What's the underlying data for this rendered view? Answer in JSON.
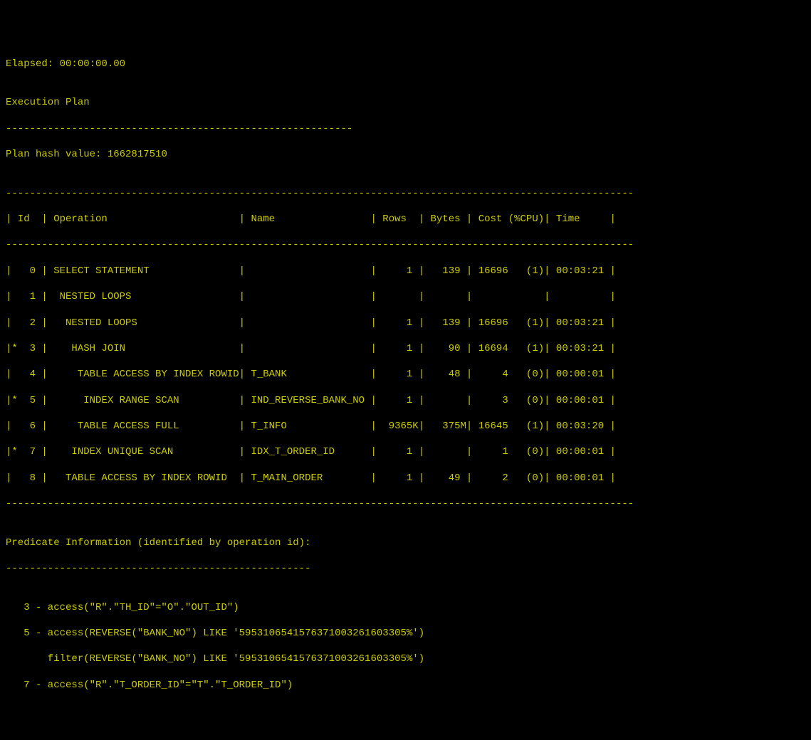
{
  "elapsed_label": "Elapsed: ",
  "elapsed_value": "00:00:00.00",
  "blank1": "",
  "exec_plan_title": "Execution Plan",
  "exec_plan_divider": "----------------------------------------------------------",
  "plan_hash_label": "Plan hash value: ",
  "plan_hash_value": "1662817510",
  "blank2": "",
  "table_divider": "---------------------------------------------------------------------------------------------------------",
  "header_row": "| Id  | Operation                      | Name                | Rows  | Bytes | Cost (%CPU)| Time     |",
  "rows": [
    "|   0 | SELECT STATEMENT               |                     |     1 |   139 | 16696   (1)| 00:03:21 |",
    "|   1 |  NESTED LOOPS                  |                     |       |       |            |          |",
    "|   2 |   NESTED LOOPS                 |                     |     1 |   139 | 16696   (1)| 00:03:21 |",
    "|*  3 |    HASH JOIN                   |                     |     1 |    90 | 16694   (1)| 00:03:21 |",
    "|   4 |     TABLE ACCESS BY INDEX ROWID| T_BANK              |     1 |    48 |     4   (0)| 00:00:01 |",
    "|*  5 |      INDEX RANGE SCAN          | IND_REVERSE_BANK_NO |     1 |       |     3   (0)| 00:00:01 |",
    "|   6 |     TABLE ACCESS FULL          | T_INFO              |  9365K|   375M| 16645   (1)| 00:03:20 |",
    "|*  7 |    INDEX UNIQUE SCAN           | IDX_T_ORDER_ID      |     1 |       |     1   (0)| 00:00:01 |",
    "|   8 |   TABLE ACCESS BY INDEX ROWID  | T_MAIN_ORDER        |     1 |    49 |     2   (0)| 00:00:01 |"
  ],
  "blank3": "",
  "predicate_title": "Predicate Information (identified by operation id):",
  "predicate_divider": "---------------------------------------------------",
  "blank4": "",
  "predicates": [
    "   3 - access(\"R\".\"TH_ID\"=\"O\".\"OUT_ID\")",
    "   5 - access(REVERSE(\"BANK_NO\") LIKE '5953106541576371003261603305%')",
    "       filter(REVERSE(\"BANK_NO\") LIKE '5953106541576371003261603305%')",
    "   7 - access(\"R\".\"T_ORDER_ID\"=\"T\".\"T_ORDER_ID\")"
  ],
  "chart_data": {
    "type": "table",
    "title": "Execution Plan",
    "plan_hash_value": 1662817510,
    "elapsed": "00:00:00.00",
    "columns": [
      "Id",
      "Operation",
      "Name",
      "Rows",
      "Bytes",
      "Cost (%CPU)",
      "Time"
    ],
    "data": [
      {
        "id": 0,
        "flag": "",
        "operation": "SELECT STATEMENT",
        "name": "",
        "rows": 1,
        "bytes": 139,
        "cost": 16696,
        "cpu_pct": 1,
        "time": "00:03:21"
      },
      {
        "id": 1,
        "flag": "",
        "operation": "NESTED LOOPS",
        "name": "",
        "rows": null,
        "bytes": null,
        "cost": null,
        "cpu_pct": null,
        "time": ""
      },
      {
        "id": 2,
        "flag": "",
        "operation": "NESTED LOOPS",
        "name": "",
        "rows": 1,
        "bytes": 139,
        "cost": 16696,
        "cpu_pct": 1,
        "time": "00:03:21"
      },
      {
        "id": 3,
        "flag": "*",
        "operation": "HASH JOIN",
        "name": "",
        "rows": 1,
        "bytes": 90,
        "cost": 16694,
        "cpu_pct": 1,
        "time": "00:03:21"
      },
      {
        "id": 4,
        "flag": "",
        "operation": "TABLE ACCESS BY INDEX ROWID",
        "name": "T_BANK",
        "rows": 1,
        "bytes": 48,
        "cost": 4,
        "cpu_pct": 0,
        "time": "00:00:01"
      },
      {
        "id": 5,
        "flag": "*",
        "operation": "INDEX RANGE SCAN",
        "name": "IND_REVERSE_BANK_NO",
        "rows": 1,
        "bytes": null,
        "cost": 3,
        "cpu_pct": 0,
        "time": "00:00:01"
      },
      {
        "id": 6,
        "flag": "",
        "operation": "TABLE ACCESS FULL",
        "name": "T_INFO",
        "rows": "9365K",
        "bytes": "375M",
        "cost": 16645,
        "cpu_pct": 1,
        "time": "00:03:20"
      },
      {
        "id": 7,
        "flag": "*",
        "operation": "INDEX UNIQUE SCAN",
        "name": "IDX_T_ORDER_ID",
        "rows": 1,
        "bytes": null,
        "cost": 1,
        "cpu_pct": 0,
        "time": "00:00:01"
      },
      {
        "id": 8,
        "flag": "",
        "operation": "TABLE ACCESS BY INDEX ROWID",
        "name": "T_MAIN_ORDER",
        "rows": 1,
        "bytes": 49,
        "cost": 2,
        "cpu_pct": 0,
        "time": "00:00:01"
      }
    ],
    "predicates": [
      {
        "id": 3,
        "type": "access",
        "expr": "\"R\".\"TH_ID\"=\"O\".\"OUT_ID\""
      },
      {
        "id": 5,
        "type": "access",
        "expr": "REVERSE(\"BANK_NO\") LIKE '5953106541576371003261603305%'"
      },
      {
        "id": 5,
        "type": "filter",
        "expr": "REVERSE(\"BANK_NO\") LIKE '5953106541576371003261603305%'"
      },
      {
        "id": 7,
        "type": "access",
        "expr": "\"R\".\"T_ORDER_ID\"=\"T\".\"T_ORDER_ID\""
      }
    ]
  }
}
